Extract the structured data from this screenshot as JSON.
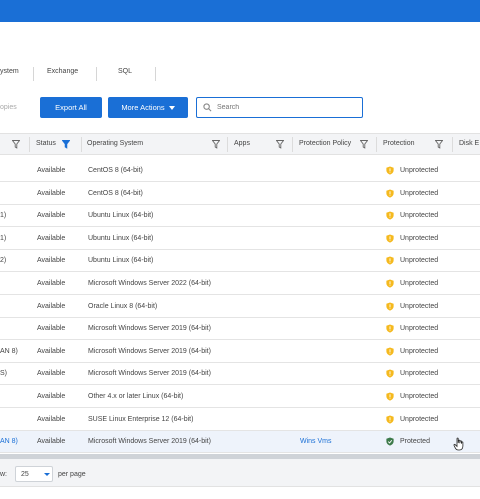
{
  "colors": {
    "accent": "#1a6fd6",
    "warning": "#f5b91e",
    "protected": "#3d7a4a"
  },
  "tabs": [
    {
      "label": "ystem"
    },
    {
      "label": "Exchange"
    },
    {
      "label": "SQL"
    }
  ],
  "toolbar": {
    "copies_label": "opies",
    "export_label": "Export All",
    "more_actions_label": "More Actions",
    "search_placeholder": "Search"
  },
  "columns": {
    "status": "Status",
    "os": "Operating System",
    "apps": "Apps",
    "policy": "Protection Policy",
    "protection": "Protection",
    "disk": "Disk E"
  },
  "rows": [
    {
      "name": "",
      "status": "Available",
      "os": "CentOS 8 (64-bit)",
      "policy": "",
      "protection": "Unprotected",
      "icon": "warning-shield-icon"
    },
    {
      "name": "",
      "status": "Available",
      "os": "CentOS 8 (64-bit)",
      "policy": "",
      "protection": "Unprotected",
      "icon": "warning-shield-icon"
    },
    {
      "name": "1)",
      "status": "Available",
      "os": "Ubuntu Linux (64-bit)",
      "policy": "",
      "protection": "Unprotected",
      "icon": "warning-shield-icon"
    },
    {
      "name": "1)",
      "status": "Available",
      "os": "Ubuntu Linux (64-bit)",
      "policy": "",
      "protection": "Unprotected",
      "icon": "warning-shield-icon"
    },
    {
      "name": "2)",
      "status": "Available",
      "os": "Ubuntu Linux (64-bit)",
      "policy": "",
      "protection": "Unprotected",
      "icon": "warning-shield-icon"
    },
    {
      "name": "",
      "status": "Available",
      "os": "Microsoft Windows Server 2022 (64-bit)",
      "policy": "",
      "protection": "Unprotected",
      "icon": "warning-shield-icon"
    },
    {
      "name": "",
      "status": "Available",
      "os": "Oracle Linux 8 (64-bit)",
      "policy": "",
      "protection": "Unprotected",
      "icon": "warning-shield-icon"
    },
    {
      "name": "",
      "status": "Available",
      "os": "Microsoft Windows Server 2019 (64-bit)",
      "policy": "",
      "protection": "Unprotected",
      "icon": "warning-shield-icon"
    },
    {
      "name": "AN 8)",
      "status": "Available",
      "os": "Microsoft Windows Server 2019 (64-bit)",
      "policy": "",
      "protection": "Unprotected",
      "icon": "warning-shield-icon"
    },
    {
      "name": "S)",
      "status": "Available",
      "os": "Microsoft Windows Server 2019 (64-bit)",
      "policy": "",
      "protection": "Unprotected",
      "icon": "warning-shield-icon"
    },
    {
      "name": "",
      "status": "Available",
      "os": "Other 4.x or later Linux (64-bit)",
      "policy": "",
      "protection": "Unprotected",
      "icon": "warning-shield-icon"
    },
    {
      "name": "",
      "status": "Available",
      "os": "SUSE Linux Enterprise 12 (64-bit)",
      "policy": "",
      "protection": "Unprotected",
      "icon": "warning-shield-icon"
    },
    {
      "name": "AN 8)",
      "status": "Available",
      "os": "Microsoft Windows Server 2019 (64-bit)",
      "policy": "Wins Vms",
      "protection": "Protected",
      "icon": "check-shield-icon"
    }
  ],
  "footer": {
    "rows_label": "w:",
    "rows_value": "25",
    "per_page_label": "per page"
  }
}
